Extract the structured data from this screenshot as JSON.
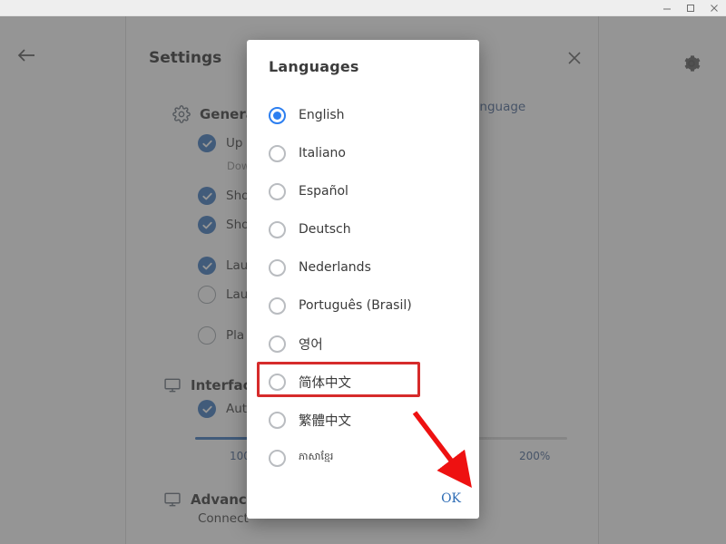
{
  "window": {
    "buttons": [
      {
        "name": "minimize",
        "icon": "minimize-icon"
      },
      {
        "name": "maximize",
        "icon": "maximize-icon"
      },
      {
        "name": "close",
        "icon": "close-icon"
      }
    ]
  },
  "page": {
    "title": "Settings",
    "back_icon": "back-arrow-icon",
    "gear_icon": "gear-icon",
    "close_icon": "close-icon",
    "change_language_link": "e Language",
    "sections": [
      {
        "id": "general",
        "icon": "gear-icon",
        "title": "Genera",
        "options": [
          {
            "label": "Up",
            "checked": true,
            "sub": "Dow"
          },
          {
            "label": "Sho",
            "checked": true
          },
          {
            "label": "Sho",
            "checked": true
          },
          {
            "label": "Lau",
            "checked": true
          },
          {
            "label": "Lau",
            "checked": false
          },
          {
            "label": "Pla",
            "checked": false
          }
        ]
      },
      {
        "id": "interface",
        "icon": "monitor-icon",
        "title": "Interfac",
        "options": [
          {
            "label": "Aut",
            "checked": true
          }
        ],
        "slider": {
          "min_label": "100",
          "max_label": "200%"
        }
      },
      {
        "id": "advanced",
        "icon": "monitor-icon",
        "title": "Advanc",
        "text": "Connect"
      }
    ]
  },
  "dialog": {
    "title": "Languages",
    "ok_label": "OK",
    "languages": [
      {
        "label": "English",
        "selected": true,
        "script": "latin"
      },
      {
        "label": "Italiano",
        "selected": false,
        "script": "latin"
      },
      {
        "label": "Español",
        "selected": false,
        "script": "latin"
      },
      {
        "label": "Deutsch",
        "selected": false,
        "script": "latin"
      },
      {
        "label": "Nederlands",
        "selected": false,
        "script": "latin"
      },
      {
        "label": "Português (Brasil)",
        "selected": false,
        "script": "latin"
      },
      {
        "label": "영어",
        "selected": false,
        "script": "cjk"
      },
      {
        "label": "简体中文",
        "selected": false,
        "script": "cjk"
      },
      {
        "label": "繁體中文",
        "selected": false,
        "script": "cjk"
      },
      {
        "label": "ភាសាខ្មែរ",
        "selected": false,
        "script": "khmer"
      }
    ]
  },
  "annotations": {
    "highlight_target": "简体中文",
    "highlight_color": "#d62b2b",
    "arrow_color": "#ee1111",
    "arrow_target": "OK"
  },
  "colors": {
    "accent": "#2d7ff0",
    "checkbox_on": "#2b6cb8",
    "link": "#3a5a8c",
    "scrim": "#505050",
    "dialog_bg": "#ffffff",
    "titlebar_bg": "#eeeeee"
  }
}
